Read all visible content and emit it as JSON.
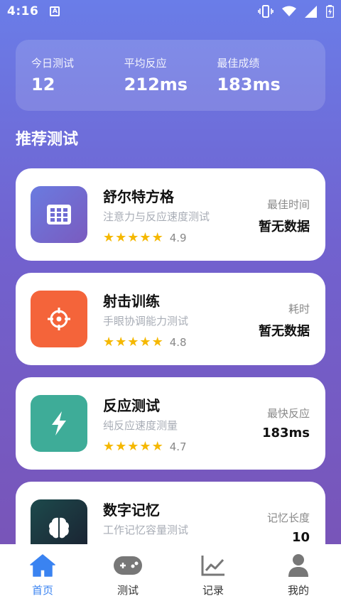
{
  "status_bar": {
    "time": "4:16",
    "notification_icon": "a-square-icon"
  },
  "stats": [
    {
      "label": "今日测试",
      "value": "12"
    },
    {
      "label": "平均反应",
      "value": "212ms"
    },
    {
      "label": "最佳成绩",
      "value": "183ms"
    }
  ],
  "section_title": "推荐测试",
  "cards": [
    {
      "title": "舒尔特方格",
      "subtitle": "注意力与反应速度测试",
      "rating": "4.9",
      "metric_label": "最佳时间",
      "metric_value": "暂无数据",
      "icon": "grid-icon",
      "color": "#6a6fd6"
    },
    {
      "title": "射击训练",
      "subtitle": "手眼协调能力测试",
      "rating": "4.8",
      "metric_label": "耗时",
      "metric_value": "暂无数据",
      "icon": "crosshair-icon",
      "color": "#f4643a"
    },
    {
      "title": "反应测试",
      "subtitle": "纯反应速度测量",
      "rating": "4.7",
      "metric_label": "最快反应",
      "metric_value": "183ms",
      "icon": "bolt-icon",
      "color": "#3eac98"
    },
    {
      "title": "数字记忆",
      "subtitle": "工作记忆容量测试",
      "rating": "",
      "metric_label": "记忆长度",
      "metric_value": "10",
      "icon": "brain-icon",
      "color": "#1f3a3f"
    }
  ],
  "nav": [
    {
      "label": "首页",
      "icon": "home-icon",
      "active": true
    },
    {
      "label": "测试",
      "icon": "gamepad-icon",
      "active": false
    },
    {
      "label": "记录",
      "icon": "chart-icon",
      "active": false
    },
    {
      "label": "我的",
      "icon": "person-icon",
      "active": false
    }
  ],
  "colors": {
    "accent": "#3a83f1",
    "star": "#f5b800",
    "nav_inactive": "#777777"
  }
}
